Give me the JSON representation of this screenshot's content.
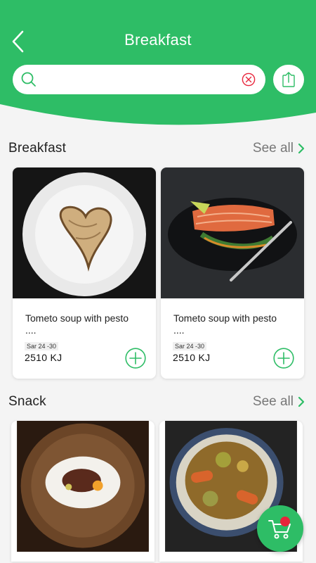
{
  "colors": {
    "accent": "#2ebd66",
    "badge": "#e8253b",
    "clear_icon": "#e8253b"
  },
  "header": {
    "title": "Breakfast",
    "back_icon": "chevron-left-icon",
    "search": {
      "value": "",
      "placeholder": "",
      "icon": "search-icon",
      "clear_icon": "close-circle-icon"
    },
    "share_icon": "share-upload-icon"
  },
  "sections": [
    {
      "title": "Breakfast",
      "see_all": "See all",
      "items": [
        {
          "name": "Tometo soup with pesto    ....",
          "date": "Sar  24 -30",
          "energy": "2510 KJ",
          "photo": "heart-pancake-plate"
        },
        {
          "name": "Tometo soup with pesto    ....",
          "date": "Sar  24 -30",
          "energy": "2510 KJ",
          "photo": "salmon-vegetables-plate"
        }
      ]
    },
    {
      "title": "Snack",
      "see_all": "See all",
      "items": [
        {
          "photo": "meat-dish-white-plate"
        },
        {
          "photo": "tagine-vegetables-bowl"
        }
      ]
    }
  ],
  "cart": {
    "icon": "cart-icon",
    "has_badge": true
  }
}
